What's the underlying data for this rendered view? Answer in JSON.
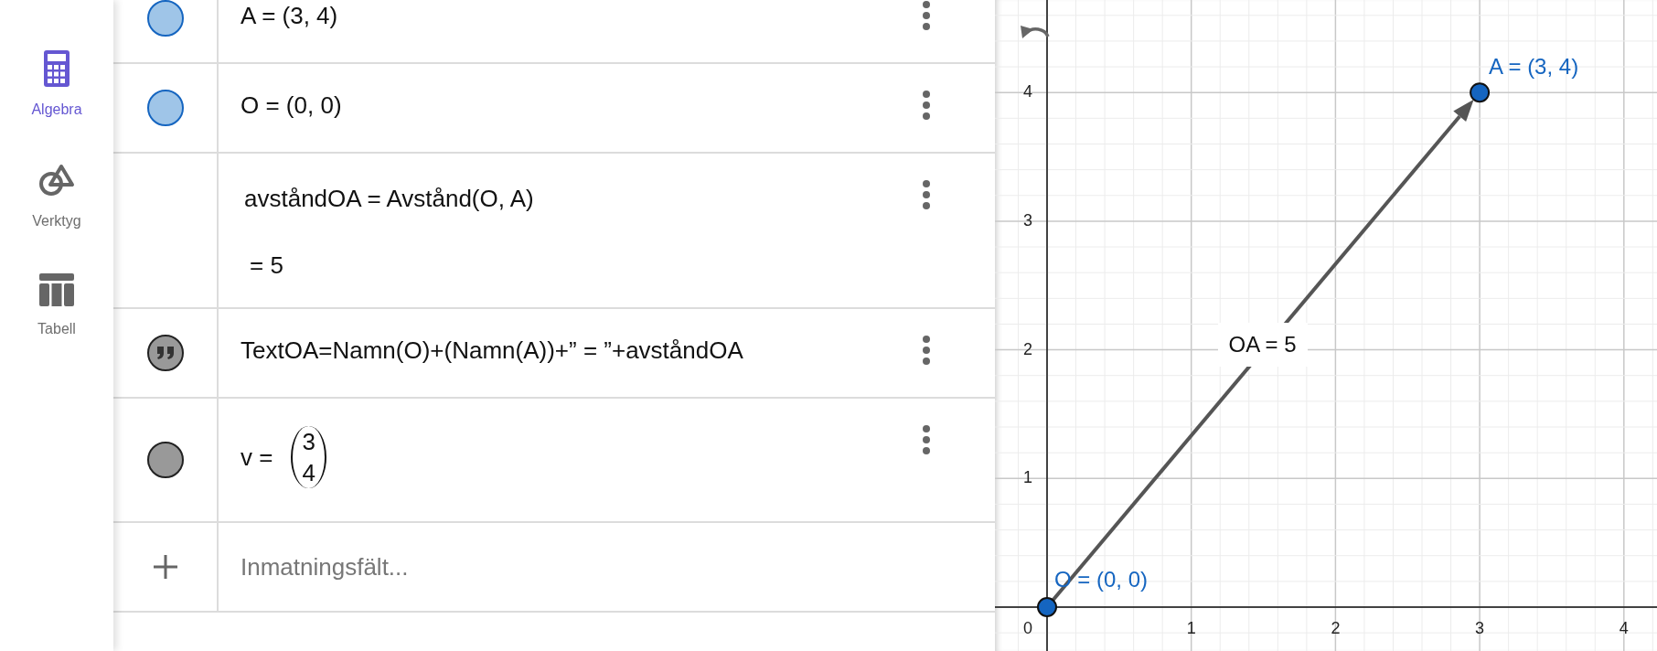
{
  "sidebar": {
    "items": [
      {
        "kind": "calculator",
        "label": "Algebra",
        "selected": true
      },
      {
        "kind": "tools",
        "label": "Verktyg",
        "selected": false
      },
      {
        "kind": "table",
        "label": "Tabell",
        "selected": false
      }
    ]
  },
  "algebra": {
    "rows": [
      {
        "kind": "point",
        "color": "#9fc5e8",
        "formula": "A = (3, 4)"
      },
      {
        "kind": "point",
        "color": "#9fc5e8",
        "formula": "O = (0, 0)"
      },
      {
        "kind": "expression",
        "formula": "avståndOA = Avstånd(O, A)",
        "result": "= 5"
      },
      {
        "kind": "text",
        "color": "#999999",
        "formula": "TextOA=Namn(O)+(Namn(A))+” = ”+avståndOA"
      },
      {
        "kind": "vector",
        "color": "#999999",
        "name": "v =",
        "components": [
          "3",
          "4"
        ]
      }
    ],
    "input": {
      "placeholder": "Inmatningsfält..."
    }
  },
  "graph": {
    "y_ticks": [
      "4",
      "3",
      "2",
      "1"
    ],
    "x_ticks": [
      "1",
      "2",
      "3",
      "4"
    ],
    "origin_label": "0",
    "points": [
      {
        "label": "A = (3, 4)"
      },
      {
        "label": "O = (0, 0)"
      }
    ],
    "vector_label": "OA = 5"
  }
}
